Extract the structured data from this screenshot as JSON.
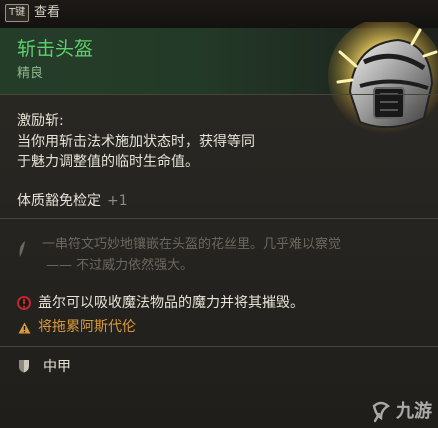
{
  "topbar": {
    "key_hint": "T键",
    "view_label": "查看"
  },
  "item": {
    "name": "斩击头盔",
    "rarity": "精良",
    "passive": {
      "title": "激励斩:",
      "description": [
        "当你用斩击法术施加状态时，获得等同",
        "于魅力调整值的临时生命值。"
      ]
    },
    "saving_throw": {
      "label": "体质豁免检定",
      "bonus": "+1"
    },
    "flavor": [
      "一串符文巧妙地镶嵌在头盔的花丝里。几乎难以察觉",
      "—— 不过威力依然强大。"
    ],
    "special": "盖尔可以吸收魔法物品的魔力并将其摧毁。",
    "warning": "将拖累阿斯代伦",
    "armor_type": "中甲"
  },
  "colors": {
    "item_name": "#5dd06c",
    "rarity": "#8fb68d",
    "warning": "#d89a3a",
    "special_icon": "#c0282c"
  },
  "icons": {
    "item_art": "helmet-icon",
    "flavor": "quill-icon",
    "special": "no-consume-icon",
    "warning": "warning-icon",
    "armor": "shield-icon"
  },
  "watermark": {
    "text": "九游"
  }
}
